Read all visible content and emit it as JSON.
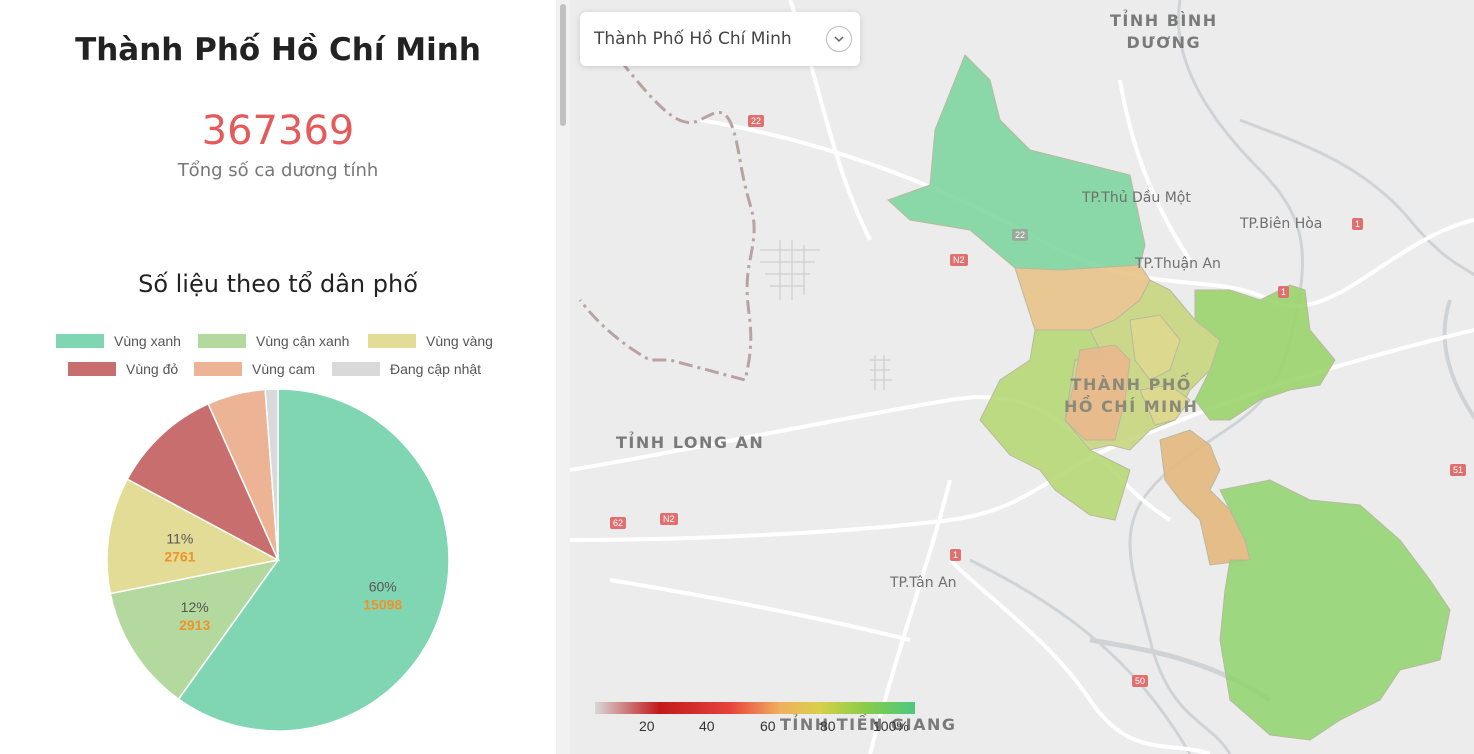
{
  "panel": {
    "title": "Thành Phố Hồ Chí Minh",
    "total_cases": "367369",
    "total_label": "Tổng số ca dương tính",
    "subtitle": "Số liệu theo tổ dân phố"
  },
  "chart_data": {
    "type": "pie",
    "legend": [
      {
        "label": "Vùng xanh",
        "color": "#80d6b3"
      },
      {
        "label": "Vùng cận xanh",
        "color": "#b3d99e"
      },
      {
        "label": "Vùng vàng",
        "color": "#e2dc96"
      },
      {
        "label": "Vùng đỏ",
        "color": "#c96e6e"
      },
      {
        "label": "Vùng cam",
        "color": "#ecb395"
      },
      {
        "label": "Đang cập nhật",
        "color": "#d9d9d9"
      }
    ],
    "slices": [
      {
        "label": "Vùng xanh",
        "color": "#80d6b3",
        "percent": 60,
        "value": 15098,
        "percent_text": "60%",
        "value_text": "15098"
      },
      {
        "label": "Vùng cận xanh",
        "color": "#b3d99e",
        "percent": 12,
        "value": 2913,
        "percent_text": "12%",
        "value_text": "2913"
      },
      {
        "label": "Vùng vàng",
        "color": "#e2dc96",
        "percent": 11,
        "value": 2761,
        "percent_text": "11%",
        "value_text": "2761"
      },
      {
        "label": "Vùng đỏ",
        "color": "#c96e6e",
        "percent": 10.5,
        "value": null
      },
      {
        "label": "Vùng cam",
        "color": "#ecb395",
        "percent": 5.5,
        "value": null
      },
      {
        "label": "Đang cập nhật",
        "color": "#d9d9d9",
        "percent": 1.2,
        "value": null
      }
    ],
    "value_label_color": "#f0922a"
  },
  "map": {
    "selector": {
      "value": "Thành Phố Hồ Chí Minh"
    },
    "labels": {
      "binh_duong": "TỈNH BÌNH\nDƯƠNG",
      "thu_dau_mot": "TP.Thủ Dầu Một",
      "bien_hoa": "TP.Biên Hòa",
      "thuan_an": "TP.Thuận An",
      "hcm": "THÀNH PHỐ\nHỒ CHÍ MINH",
      "long_an": "TỈNH LONG AN",
      "tan_an": "TP.Tân An",
      "tien_giang": "TỈNH TIỀN GIANG"
    },
    "road_badges": [
      "22",
      "22",
      "N2",
      "1",
      "1",
      "1",
      "51",
      "62",
      "N2",
      "1",
      "50"
    ],
    "colorbar": {
      "ticks": [
        "20",
        "40",
        "60",
        "80",
        "100%"
      ]
    }
  }
}
